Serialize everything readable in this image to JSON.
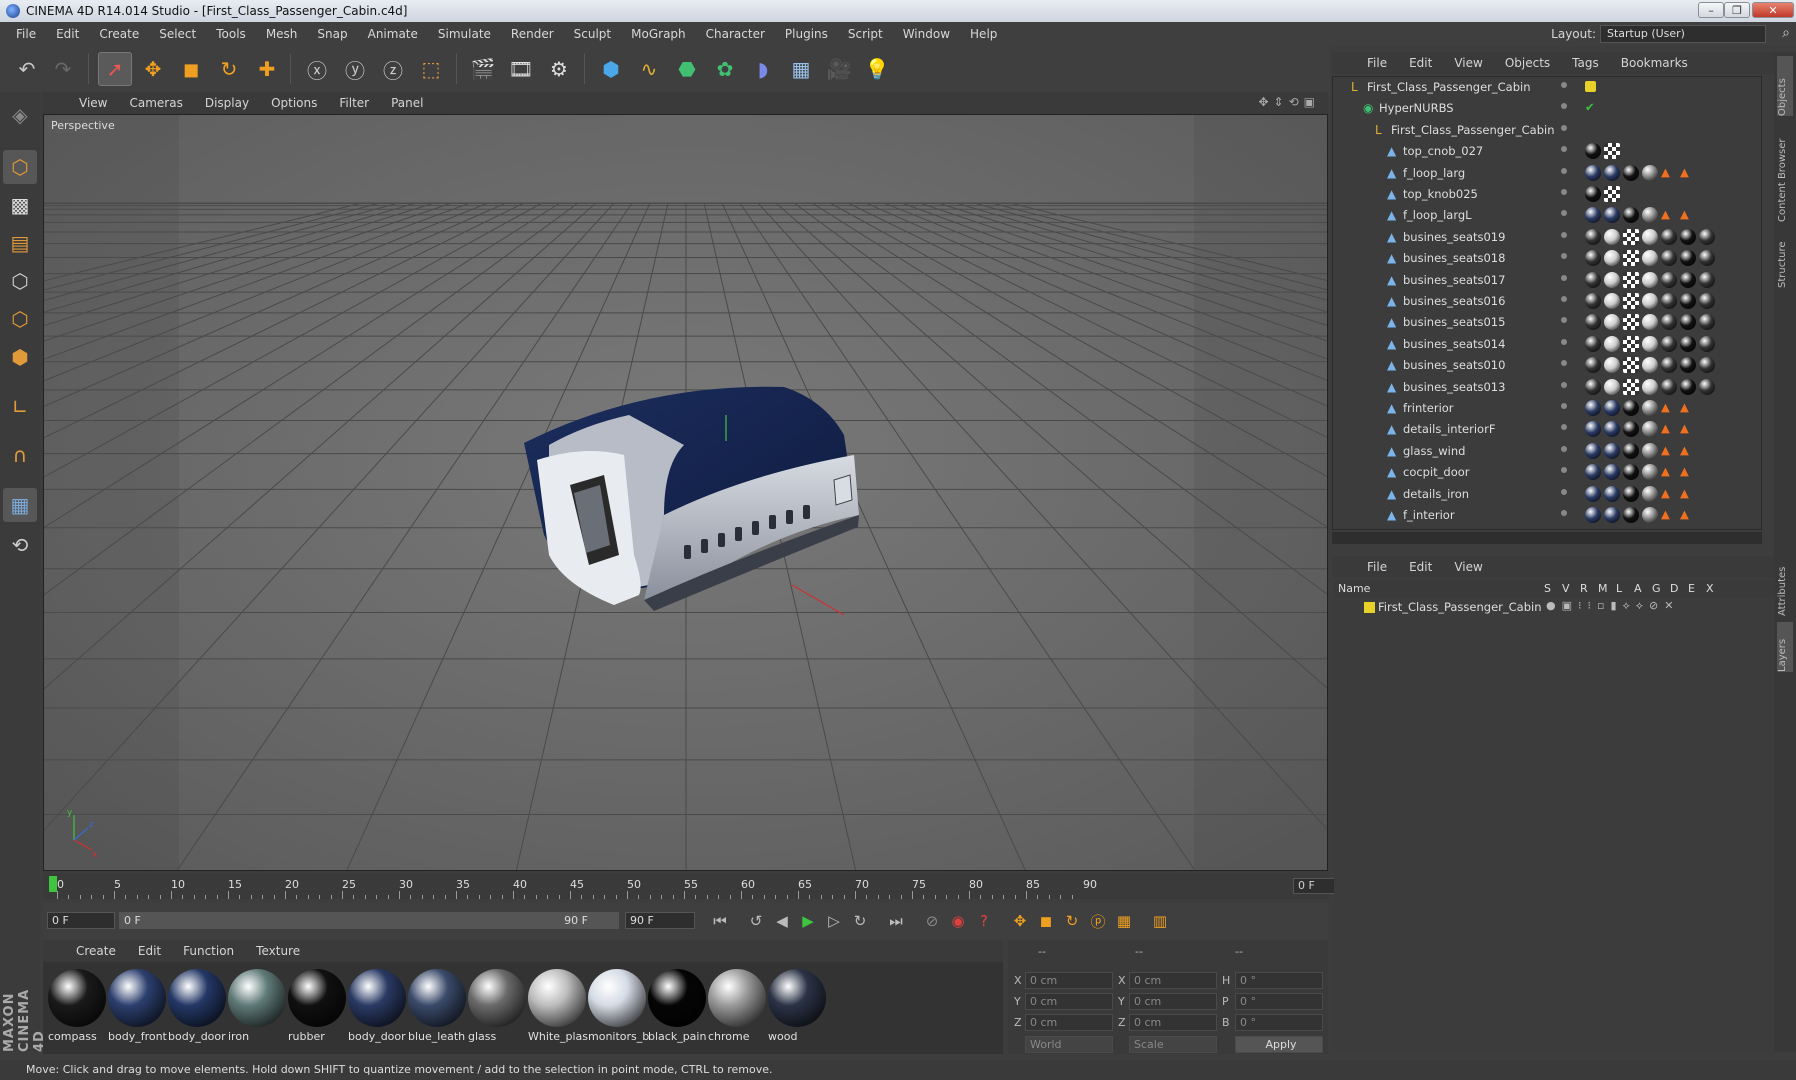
{
  "window": {
    "title": "CINEMA 4D R14.014 Studio - [First_Class_Passenger_Cabin.c4d]",
    "minimize": "–",
    "restore": "❐",
    "close": "✕"
  },
  "menubar": {
    "items": [
      "File",
      "Edit",
      "Create",
      "Select",
      "Tools",
      "Mesh",
      "Snap",
      "Animate",
      "Simulate",
      "Render",
      "Sculpt",
      "MoGraph",
      "Character",
      "Plugins",
      "Script",
      "Window",
      "Help"
    ],
    "layout_label": "Layout:",
    "layout_value": "Startup (User)"
  },
  "toolbar": {
    "icons": [
      "undo-icon",
      "redo-icon",
      "live-selection-icon",
      "move-icon",
      "scale-icon",
      "rotate-icon",
      "add-object-icon",
      "x-axis-lock-icon",
      "y-axis-lock-icon",
      "z-axis-lock-icon",
      "coordinate-system-icon",
      "render-view-icon",
      "render-picture-viewer-icon",
      "render-settings-icon",
      "cube-icon",
      "spline-pen-icon",
      "nurbs-icon",
      "array-icon",
      "deformer-icon",
      "floor-icon",
      "camera-icon",
      "light-icon"
    ]
  },
  "viewport": {
    "menu": [
      "View",
      "Cameras",
      "Display",
      "Options",
      "Filter",
      "Panel"
    ],
    "label": "Perspective"
  },
  "timeline": {
    "ticks": [
      "0",
      "5",
      "10",
      "15",
      "20",
      "25",
      "30",
      "35",
      "40",
      "45",
      "50",
      "55",
      "60",
      "65",
      "70",
      "75",
      "80",
      "85",
      "90"
    ],
    "current_frame": "0 F",
    "start_field": "0 F",
    "range_start": "0 F",
    "range_end": "90 F",
    "end_field": "90 F"
  },
  "materials": {
    "menu": [
      "Create",
      "Edit",
      "Function",
      "Texture"
    ],
    "items": [
      {
        "name": "compass",
        "color": "#1a1a1a"
      },
      {
        "name": "body_front",
        "color": "#2c3f6e"
      },
      {
        "name": "body_door",
        "color": "#243866"
      },
      {
        "name": "iron",
        "color": "#5f7a78"
      },
      {
        "name": "rubber",
        "color": "#101010"
      },
      {
        "name": "body_door",
        "color": "#2a3a64"
      },
      {
        "name": "blue_leath",
        "color": "#3a4a6a"
      },
      {
        "name": "glass",
        "color": "#6a6a6a"
      },
      {
        "name": "White_plas",
        "color": "#bdbdbd"
      },
      {
        "name": "monitors_b",
        "color": "#d5dbe5"
      },
      {
        "name": "black_pain",
        "color": "#050505"
      },
      {
        "name": "chrome",
        "color": "#9a9a9a"
      },
      {
        "name": "wood",
        "color": "#2b3346"
      }
    ]
  },
  "coordinates": {
    "headers": [
      "--",
      "--",
      "--"
    ],
    "rows": [
      {
        "a": "X",
        "av": "0 cm",
        "b": "X",
        "bv": "0 cm",
        "c": "H",
        "cv": "0 °"
      },
      {
        "a": "Y",
        "av": "0 cm",
        "b": "Y",
        "bv": "0 cm",
        "c": "P",
        "cv": "0 °"
      },
      {
        "a": "Z",
        "av": "0 cm",
        "b": "Z",
        "bv": "0 cm",
        "c": "B",
        "cv": "0 °"
      }
    ],
    "world": "World",
    "scale": "Scale",
    "apply": "Apply"
  },
  "status": "Move: Click and drag to move elements. Hold down SHIFT to quantize movement / add to the selection in point mode, CTRL to remove.",
  "objects_panel": {
    "menu": [
      "File",
      "Edit",
      "View",
      "Objects",
      "Tags",
      "Bookmarks"
    ],
    "tree": [
      {
        "name": "First_Class_Passenger_Cabin",
        "depth": 0,
        "icon": "null-object-icon"
      },
      {
        "name": "HyperNURBS",
        "depth": 1,
        "icon": "hypernurbs-icon"
      },
      {
        "name": "First_Class_Passenger_Cabin",
        "depth": 2,
        "icon": "null-object-icon"
      },
      {
        "name": "top_cnob_027",
        "depth": 3,
        "icon": "polygon-object-icon"
      },
      {
        "name": "f_loop_larg",
        "depth": 3,
        "icon": "polygon-object-icon"
      },
      {
        "name": "top_knob025",
        "depth": 3,
        "icon": "polygon-object-icon"
      },
      {
        "name": "f_loop_largL",
        "depth": 3,
        "icon": "polygon-object-icon"
      },
      {
        "name": "busines_seats019",
        "depth": 3,
        "icon": "polygon-object-icon"
      },
      {
        "name": "busines_seats018",
        "depth": 3,
        "icon": "polygon-object-icon"
      },
      {
        "name": "busines_seats017",
        "depth": 3,
        "icon": "polygon-object-icon"
      },
      {
        "name": "busines_seats016",
        "depth": 3,
        "icon": "polygon-object-icon"
      },
      {
        "name": "busines_seats015",
        "depth": 3,
        "icon": "polygon-object-icon"
      },
      {
        "name": "busines_seats014",
        "depth": 3,
        "icon": "polygon-object-icon"
      },
      {
        "name": "busines_seats010",
        "depth": 3,
        "icon": "polygon-object-icon"
      },
      {
        "name": "busines_seats013",
        "depth": 3,
        "icon": "polygon-object-icon"
      },
      {
        "name": "frinterior",
        "depth": 3,
        "icon": "polygon-object-icon"
      },
      {
        "name": "details_interiorF",
        "depth": 3,
        "icon": "polygon-object-icon"
      },
      {
        "name": "glass_wind",
        "depth": 3,
        "icon": "polygon-object-icon"
      },
      {
        "name": "cocpit_door",
        "depth": 3,
        "icon": "polygon-object-icon"
      },
      {
        "name": "details_iron",
        "depth": 3,
        "icon": "polygon-object-icon"
      },
      {
        "name": "f_interior",
        "depth": 3,
        "icon": "polygon-object-icon"
      }
    ]
  },
  "layers_panel": {
    "menu": [
      "File",
      "Edit",
      "View"
    ],
    "columns": [
      "Name",
      "S",
      "V",
      "R",
      "M",
      "L",
      "A",
      "G",
      "D",
      "E",
      "X"
    ],
    "layer_name": "First_Class_Passenger_Cabin",
    "layer_color": "#e8d22a"
  },
  "side_tabs": [
    "Objects",
    "Content Browser",
    "Structure",
    "Attributes",
    "Layers"
  ],
  "brand": "MAXON CINEMA 4D"
}
